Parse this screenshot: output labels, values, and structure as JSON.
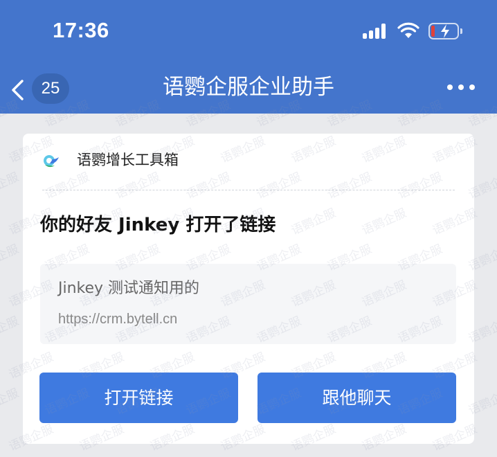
{
  "status_bar": {
    "time": "17:36",
    "icons": [
      "signal-icon",
      "wifi-icon",
      "battery-charging-icon"
    ]
  },
  "nav": {
    "back_icon": "chevron-left-icon",
    "unread_count": "25",
    "title": "语鹦企服企业助手",
    "more_icon": "more-dots-icon",
    "bg_color": "#4475cc"
  },
  "card": {
    "app_icon": "app-logo-icon",
    "app_name": "语鹦增长工具箱",
    "headline": "你的好友 Jinkey 打开了链接",
    "link": {
      "title": "Jinkey 测试通知用的",
      "url": "https://crm.bytell.cn"
    },
    "buttons": {
      "open_link": "打开链接",
      "chat": "跟他聊天"
    },
    "button_color": "#3f7ae0"
  },
  "watermark": {
    "text": "语鹦企服"
  }
}
